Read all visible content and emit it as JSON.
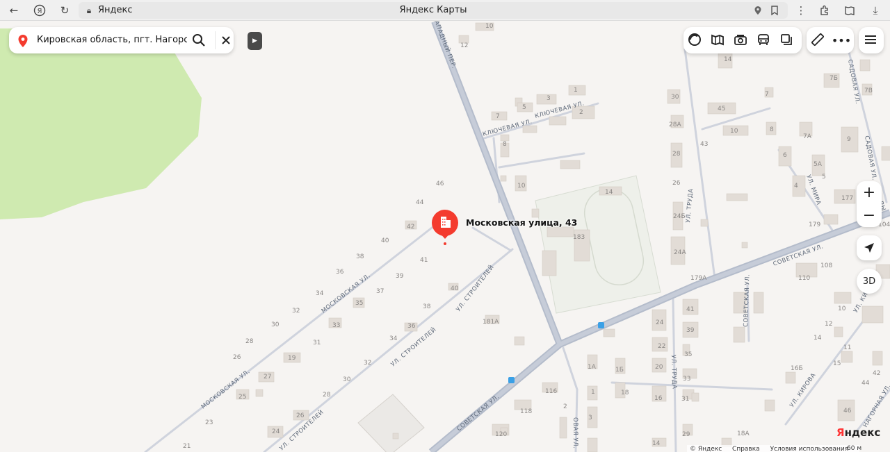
{
  "browser": {
    "site_name": "Яндекс",
    "page_title": "Яндекс Карты"
  },
  "search": {
    "query": "Кировская область, пгт. Нагорск, ул."
  },
  "marker": {
    "label": "Московская улица, 43"
  },
  "controls": {
    "zoom_in": "+",
    "zoom_out": "−",
    "mode_3d": "3D"
  },
  "brand": {
    "logo_y": "Я",
    "logo_rest": "ндекс"
  },
  "footer": {
    "copyright": "© Яндекс",
    "help": "Справка",
    "terms": "Условия использования",
    "scale": "60 м"
  },
  "streets": {
    "moskovskaya_1": "МОСКОВСКАЯ УЛ.",
    "moskovskaya_2": "МОСКОВСКАЯ УЛ.",
    "stroiteley_1": "УЛ. СТРОИТЕЛЕЙ",
    "stroiteley_2": "УЛ. СТРОИТЕЛЕЙ",
    "stroiteley_3": "УЛ. СТРОИТЕЛЕЙ",
    "sovetskaya_1": "СОВЕТСКАЯ УЛ.",
    "sovetskaya_2": "СОВЕТСКАЯ УЛ.",
    "sovetskaya_3": "СОВЕТСКАЯ УЛ.",
    "klyuchevaya_1": "КЛЮЧЕВАЯ УЛ.",
    "klyuchevaya_2": "КЛЮЧЕВАЯ УЛ.",
    "zapadny": "АПАДНЫЙ ПЕР.",
    "truda_1": "УЛ. ТРУДА",
    "truda_2": "УЛ. ТРУДА",
    "mira": "УЛ. МИРА",
    "sadovaya_1": "САДОВАЯ УЛ.",
    "sadovaya_2": "САДОВАЯ УЛ.",
    "kirova_1": "УЛ. КИРОВА",
    "kirova_2": "УЛ. КИР",
    "nagornaya": "НАГОРНАЯ УЛ.",
    "kuibysheva": "ВЫ",
    "polevaya": "ОВАЯ УЛ."
  },
  "house_numbers": [
    "46",
    "44",
    "42",
    "40",
    "38",
    "36",
    "34",
    "32",
    "30",
    "28",
    "26",
    "41",
    "39",
    "37",
    "35",
    "33",
    "31",
    "27",
    "25",
    "23",
    "21",
    "19",
    "40",
    "38",
    "36",
    "34",
    "32",
    "30",
    "28",
    "26",
    "24",
    "181А",
    "10",
    "12",
    "7",
    "5",
    "3",
    "1",
    "2",
    "8",
    "10",
    "14",
    "183",
    "30",
    "28А",
    "28",
    "26",
    "24Б",
    "24А",
    "179А",
    "45",
    "43",
    "10",
    "8",
    "7",
    "7А",
    "6",
    "9",
    "5А",
    "5",
    "4",
    "177",
    "179",
    "108",
    "110",
    "104",
    "7Б",
    "7В",
    "14",
    "41",
    "39",
    "35",
    "33",
    "31",
    "29",
    "24",
    "22",
    "20",
    "16",
    "18",
    "1А",
    "1Б",
    "1",
    "3",
    "2",
    "116",
    "118",
    "120",
    "10",
    "12",
    "14",
    "11",
    "15",
    "16Б",
    "44",
    "46",
    "42",
    "18А",
    "14"
  ]
}
